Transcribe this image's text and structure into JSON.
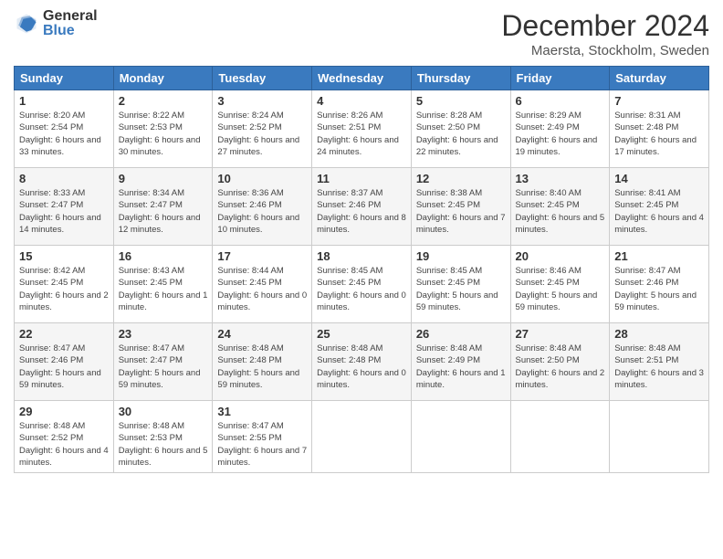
{
  "header": {
    "logo_general": "General",
    "logo_blue": "Blue",
    "month_title": "December 2024",
    "location": "Maersta, Stockholm, Sweden"
  },
  "days_of_week": [
    "Sunday",
    "Monday",
    "Tuesday",
    "Wednesday",
    "Thursday",
    "Friday",
    "Saturday"
  ],
  "weeks": [
    [
      {
        "day": 1,
        "info": "Sunrise: 8:20 AM\nSunset: 2:54 PM\nDaylight: 6 hours\nand 33 minutes."
      },
      {
        "day": 2,
        "info": "Sunrise: 8:22 AM\nSunset: 2:53 PM\nDaylight: 6 hours\nand 30 minutes."
      },
      {
        "day": 3,
        "info": "Sunrise: 8:24 AM\nSunset: 2:52 PM\nDaylight: 6 hours\nand 27 minutes."
      },
      {
        "day": 4,
        "info": "Sunrise: 8:26 AM\nSunset: 2:51 PM\nDaylight: 6 hours\nand 24 minutes."
      },
      {
        "day": 5,
        "info": "Sunrise: 8:28 AM\nSunset: 2:50 PM\nDaylight: 6 hours\nand 22 minutes."
      },
      {
        "day": 6,
        "info": "Sunrise: 8:29 AM\nSunset: 2:49 PM\nDaylight: 6 hours\nand 19 minutes."
      },
      {
        "day": 7,
        "info": "Sunrise: 8:31 AM\nSunset: 2:48 PM\nDaylight: 6 hours\nand 17 minutes."
      }
    ],
    [
      {
        "day": 8,
        "info": "Sunrise: 8:33 AM\nSunset: 2:47 PM\nDaylight: 6 hours\nand 14 minutes."
      },
      {
        "day": 9,
        "info": "Sunrise: 8:34 AM\nSunset: 2:47 PM\nDaylight: 6 hours\nand 12 minutes."
      },
      {
        "day": 10,
        "info": "Sunrise: 8:36 AM\nSunset: 2:46 PM\nDaylight: 6 hours\nand 10 minutes."
      },
      {
        "day": 11,
        "info": "Sunrise: 8:37 AM\nSunset: 2:46 PM\nDaylight: 6 hours\nand 8 minutes."
      },
      {
        "day": 12,
        "info": "Sunrise: 8:38 AM\nSunset: 2:45 PM\nDaylight: 6 hours\nand 7 minutes."
      },
      {
        "day": 13,
        "info": "Sunrise: 8:40 AM\nSunset: 2:45 PM\nDaylight: 6 hours\nand 5 minutes."
      },
      {
        "day": 14,
        "info": "Sunrise: 8:41 AM\nSunset: 2:45 PM\nDaylight: 6 hours\nand 4 minutes."
      }
    ],
    [
      {
        "day": 15,
        "info": "Sunrise: 8:42 AM\nSunset: 2:45 PM\nDaylight: 6 hours\nand 2 minutes."
      },
      {
        "day": 16,
        "info": "Sunrise: 8:43 AM\nSunset: 2:45 PM\nDaylight: 6 hours\nand 1 minute."
      },
      {
        "day": 17,
        "info": "Sunrise: 8:44 AM\nSunset: 2:45 PM\nDaylight: 6 hours\nand 0 minutes."
      },
      {
        "day": 18,
        "info": "Sunrise: 8:45 AM\nSunset: 2:45 PM\nDaylight: 6 hours\nand 0 minutes."
      },
      {
        "day": 19,
        "info": "Sunrise: 8:45 AM\nSunset: 2:45 PM\nDaylight: 5 hours\nand 59 minutes."
      },
      {
        "day": 20,
        "info": "Sunrise: 8:46 AM\nSunset: 2:45 PM\nDaylight: 5 hours\nand 59 minutes."
      },
      {
        "day": 21,
        "info": "Sunrise: 8:47 AM\nSunset: 2:46 PM\nDaylight: 5 hours\nand 59 minutes."
      }
    ],
    [
      {
        "day": 22,
        "info": "Sunrise: 8:47 AM\nSunset: 2:46 PM\nDaylight: 5 hours\nand 59 minutes."
      },
      {
        "day": 23,
        "info": "Sunrise: 8:47 AM\nSunset: 2:47 PM\nDaylight: 5 hours\nand 59 minutes."
      },
      {
        "day": 24,
        "info": "Sunrise: 8:48 AM\nSunset: 2:48 PM\nDaylight: 5 hours\nand 59 minutes."
      },
      {
        "day": 25,
        "info": "Sunrise: 8:48 AM\nSunset: 2:48 PM\nDaylight: 6 hours\nand 0 minutes."
      },
      {
        "day": 26,
        "info": "Sunrise: 8:48 AM\nSunset: 2:49 PM\nDaylight: 6 hours\nand 1 minute."
      },
      {
        "day": 27,
        "info": "Sunrise: 8:48 AM\nSunset: 2:50 PM\nDaylight: 6 hours\nand 2 minutes."
      },
      {
        "day": 28,
        "info": "Sunrise: 8:48 AM\nSunset: 2:51 PM\nDaylight: 6 hours\nand 3 minutes."
      }
    ],
    [
      {
        "day": 29,
        "info": "Sunrise: 8:48 AM\nSunset: 2:52 PM\nDaylight: 6 hours\nand 4 minutes."
      },
      {
        "day": 30,
        "info": "Sunrise: 8:48 AM\nSunset: 2:53 PM\nDaylight: 6 hours\nand 5 minutes."
      },
      {
        "day": 31,
        "info": "Sunrise: 8:47 AM\nSunset: 2:55 PM\nDaylight: 6 hours\nand 7 minutes."
      },
      null,
      null,
      null,
      null
    ]
  ]
}
